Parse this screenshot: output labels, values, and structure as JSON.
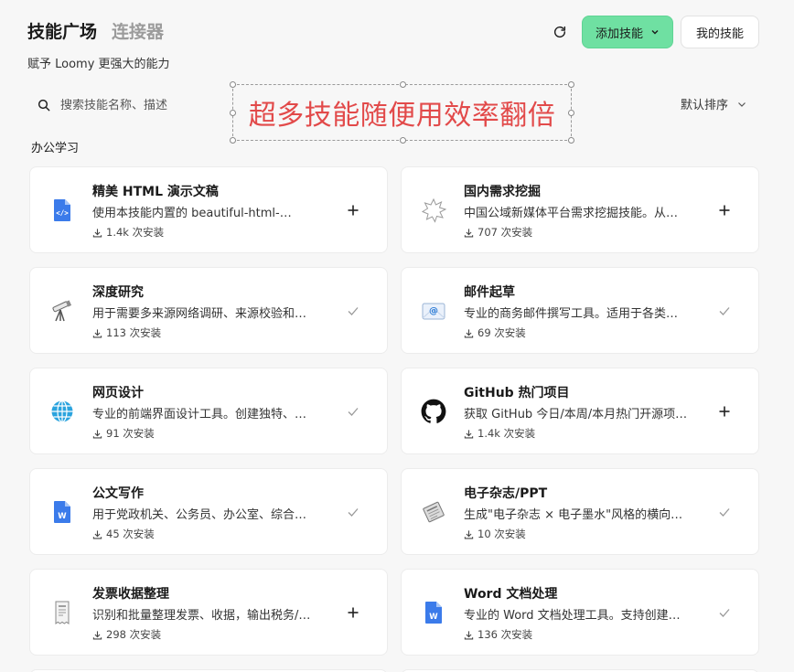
{
  "header": {
    "tab_active": "技能广场",
    "tab_inactive": "连接器",
    "subtitle": "赋予 Loomy 更强大的能力"
  },
  "actions": {
    "add_skill_label": "添加技能",
    "my_skills_label": "我的技能",
    "accent_color": "#6fe0a2"
  },
  "search": {
    "placeholder": "搜索技能名称、描述"
  },
  "promo": {
    "text": "超多技能随便用效率翻倍",
    "color": "#e24a4a"
  },
  "sort": {
    "label": "默认排序"
  },
  "section": {
    "title": "办公学习"
  },
  "skills": [
    {
      "title": "精美 HTML 演示文稿",
      "desc": "使用本技能内置的 beautiful-html-…",
      "installs": "1.4k 次安装",
      "icon": "html-doc-icon",
      "action": "add"
    },
    {
      "title": "国内需求挖掘",
      "desc": "中国公域新媒体平台需求挖掘技能。从…",
      "installs": "707 次安装",
      "icon": "burst-icon",
      "action": "add"
    },
    {
      "title": "深度研究",
      "desc": "用于需要多来源网络调研、来源校验和…",
      "installs": "113 次安装",
      "icon": "telescope-icon",
      "action": "installed"
    },
    {
      "title": "邮件起草",
      "desc": "专业的商务邮件撰写工具。适用于各类…",
      "installs": "69 次安装",
      "icon": "email-icon",
      "action": "installed"
    },
    {
      "title": "网页设计",
      "desc": "专业的前端界面设计工具。创建独特、…",
      "installs": "91 次安装",
      "icon": "globe-icon",
      "action": "installed"
    },
    {
      "title": "GitHub 热门项目",
      "desc": "获取 GitHub 今日/本周/本月热门开源项…",
      "installs": "1.4k 次安装",
      "icon": "github-icon",
      "action": "add"
    },
    {
      "title": "公文写作",
      "desc": "用于党政机关、公务员、办公室、综合…",
      "installs": "45 次安装",
      "icon": "word-doc-icon",
      "action": "installed"
    },
    {
      "title": "电子杂志/PPT",
      "desc": "生成\"电子杂志 × 电子墨水\"风格的横向…",
      "installs": "10 次安装",
      "icon": "newspaper-icon",
      "action": "installed"
    },
    {
      "title": "发票收据整理",
      "desc": "识别和批量整理发票、收据，输出税务/…",
      "installs": "298 次安装",
      "icon": "receipt-icon",
      "action": "add"
    },
    {
      "title": "Word 文档处理",
      "desc": "专业的 Word 文档处理工具。支持创建…",
      "installs": "136 次安装",
      "icon": "word-doc-icon",
      "action": "installed"
    }
  ]
}
